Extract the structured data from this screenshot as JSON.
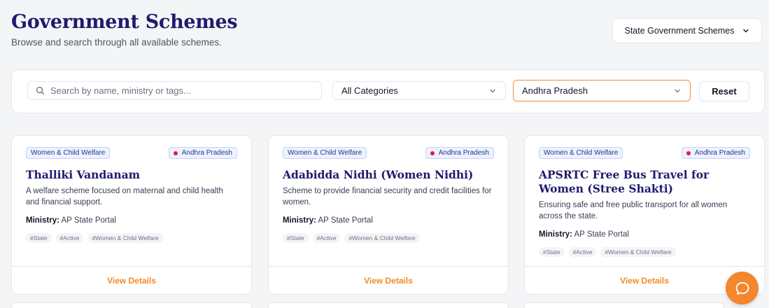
{
  "header": {
    "title": "Government Schemes",
    "subtitle": "Browse and search through all available schemes.",
    "scope_dropdown": "State Government Schemes"
  },
  "filters": {
    "search_placeholder": "Search by name, ministry or tags...",
    "category": "All Categories",
    "state": "Andhra Pradesh",
    "reset_label": "Reset"
  },
  "cards": [
    {
      "category": "Women & Child Welfare",
      "state": "Andhra Pradesh",
      "title": "Thalliki Vandanam",
      "description": "A welfare scheme focused on maternal and child health and financial support.",
      "ministry_label": "Ministry:",
      "ministry": "AP State Portal",
      "tags": [
        "#State",
        "#Active",
        "#Women & Child Welfare"
      ],
      "action": "View Details"
    },
    {
      "category": "Women & Child Welfare",
      "state": "Andhra Pradesh",
      "title": "Adabidda Nidhi (Women Nidhi)",
      "description": "Scheme to provide financial security and credit facilities for women.",
      "ministry_label": "Ministry:",
      "ministry": "AP State Portal",
      "tags": [
        "#State",
        "#Active",
        "#Women & Child Welfare"
      ],
      "action": "View Details"
    },
    {
      "category": "Women & Child Welfare",
      "state": "Andhra Pradesh",
      "title": "APSRTC Free Bus Travel for Women (Stree Shakti)",
      "description": "Ensuring safe and free public transport for all women across the state.",
      "ministry_label": "Ministry:",
      "ministry": "AP State Portal",
      "tags": [
        "#State",
        "#Active",
        "#Women & Child Welfare"
      ],
      "action": "View Details"
    }
  ],
  "colors": {
    "title": "#1e1b6e",
    "accent": "#f08a24",
    "badge_bg": "#eef2ff",
    "pin": "#e11d48"
  },
  "icons": {
    "search": "search-icon",
    "dropdown": "chevron-down-icon",
    "location": "map-pin-icon",
    "chat": "chat-bubble-icon"
  }
}
